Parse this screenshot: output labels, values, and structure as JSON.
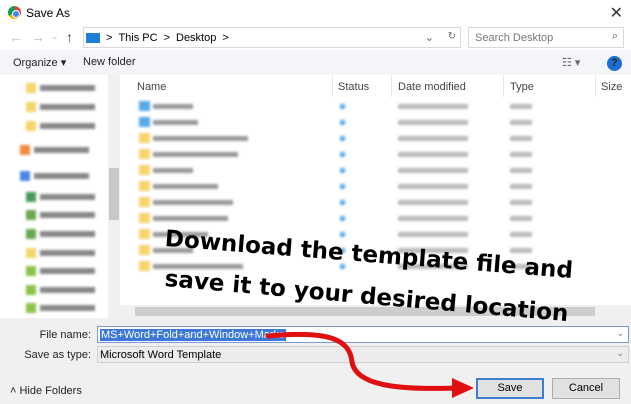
{
  "window": {
    "title": "Save As",
    "close": "✕"
  },
  "nav": {
    "back": "←",
    "forward": "→",
    "recent": "⌄",
    "up": "↑"
  },
  "address": {
    "sep": ">",
    "crumbs": [
      "This PC",
      "Desktop"
    ],
    "refresh": "↻",
    "dropdown": "⌄"
  },
  "search": {
    "placeholder": "Search Desktop",
    "icon": "⌕"
  },
  "toolbar": {
    "organize": "Organize ▾",
    "new_folder": "New folder",
    "view": "☷ ▾",
    "help": "?"
  },
  "columns": [
    "Name",
    "Status",
    "Date modified",
    "Type",
    "Size"
  ],
  "form": {
    "file_name_label": "File name:",
    "file_name_value": "MS+Word+Fold+and+Window+Marks",
    "type_label": "Save as type:",
    "type_value": "Microsoft Word Template"
  },
  "buttons": {
    "save": "Save",
    "cancel": "Cancel",
    "hide_folders": "Hide Folders"
  },
  "annotation": {
    "line1": "Download the template file and",
    "line2": "save it to your desired location",
    "arrow_color": "#e01010"
  }
}
